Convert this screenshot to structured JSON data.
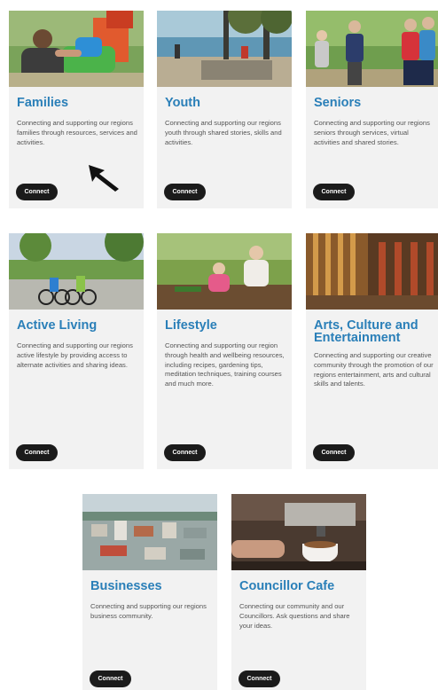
{
  "cards": [
    {
      "title": "Families",
      "description": "Connecting and supporting our regions families through resources, services and activities.",
      "button": "Connect"
    },
    {
      "title": "Youth",
      "description": "Connecting and supporting our regions youth through shared stories, skills and activities.",
      "button": "Connect"
    },
    {
      "title": "Seniors",
      "description": "Connecting and supporting our regions seniors through services, virtual activities and shared stories.",
      "button": "Connect"
    },
    {
      "title": "Active Living",
      "description": "Connecting and supporting our regions active lifestyle by providing access to alternate activities and sharing ideas.",
      "button": "Connect"
    },
    {
      "title": "Lifestyle",
      "description": "Connecting and supporting our region through health and wellbeing resources, including recipes, gardening tips, meditation techniques, training courses and much more.",
      "button": "Connect"
    },
    {
      "title": "Arts, Culture and Entertainment",
      "description": "Connecting and supporting our creative community through the promotion of our regions entertainment, arts and cultural skills and talents.",
      "button": "Connect"
    },
    {
      "title": "Businesses",
      "description": "Connecting and supporting our regions business community.",
      "button": "Connect"
    },
    {
      "title": "Councillor Cafe",
      "description": "Connecting our community and our Councillors. Ask questions and share your ideas.",
      "button": "Connect"
    }
  ],
  "colors": {
    "title": "#2a7fb8",
    "button_bg": "#1b1b1b",
    "card_bg": "#f2f2f2"
  },
  "cursor": "arrow-cursor-icon"
}
